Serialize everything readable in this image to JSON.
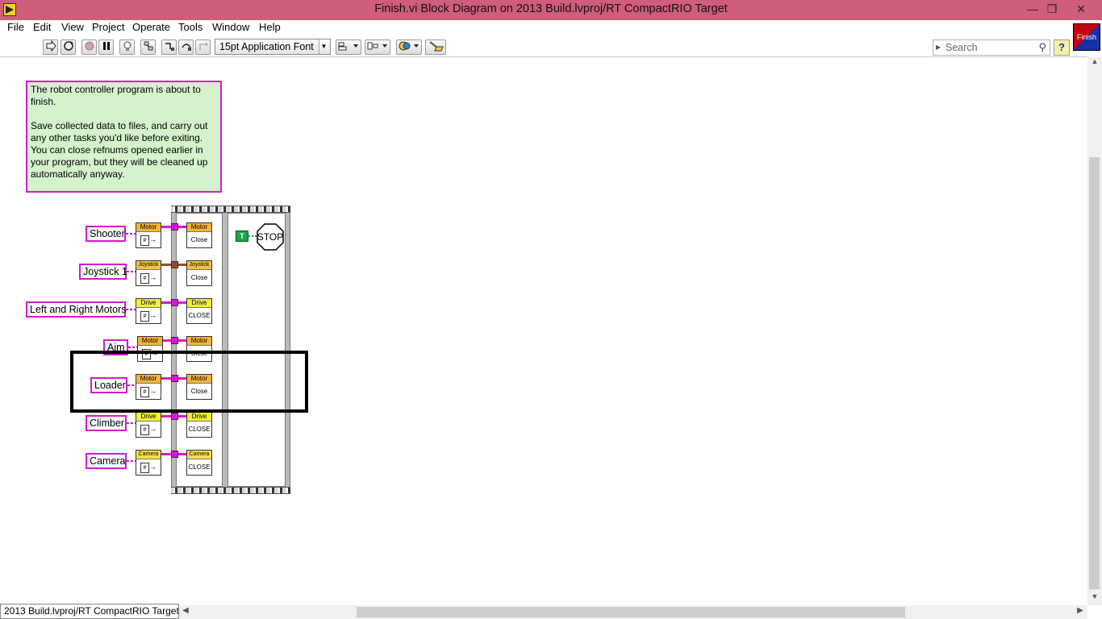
{
  "window": {
    "title": "Finish.vi Block Diagram on 2013 Build.lvproj/RT CompactRIO Target",
    "minimize": "—",
    "restore": "❐",
    "close": "✕"
  },
  "menu": [
    "File",
    "Edit",
    "View",
    "Project",
    "Operate",
    "Tools",
    "Window",
    "Help"
  ],
  "toolbar": {
    "font": "15pt Application Font",
    "search_placeholder": "Search",
    "help": "?",
    "vi_icon_label": "Finish"
  },
  "comment": "The robot controller program is about to finish.\n\nSave collected data to files, and carry out any other tasks you'd like before exiting. You can close refnums opened earlier in your program, but they will be cleaned up automatically anyway.",
  "controls": [
    {
      "label": "Shooter",
      "type": "Motor",
      "close": "Close"
    },
    {
      "label": "Joystick 1",
      "type": "Joystick",
      "close": "Close"
    },
    {
      "label": "Left and Right Motors",
      "type": "Drive",
      "close": "CLOSE"
    },
    {
      "label": "Aim",
      "type": "Motor",
      "close": "Close"
    },
    {
      "label": "Loader",
      "type": "Motor",
      "close": "Close"
    },
    {
      "label": "Climber",
      "type": "Drive",
      "close": "CLOSE"
    },
    {
      "label": "Camera",
      "type": "Camera",
      "close": "CLOSE"
    }
  ],
  "stop": {
    "constant": "T",
    "label": "STOP"
  },
  "status": "2013 Build.lvproj/RT CompactRIO Target"
}
